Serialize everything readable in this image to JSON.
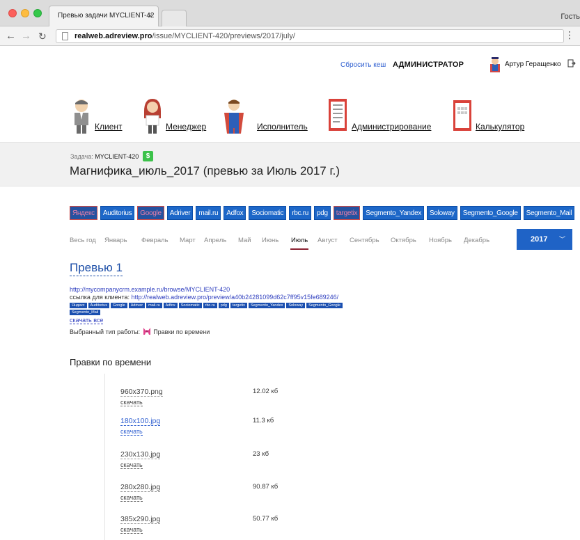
{
  "browser": {
    "tab_title": "Превью задачи MYCLIENT-42",
    "guest_label": "Гость",
    "url_host": "realweb.adreview.pro",
    "url_path": "/issue/MYCLIENT-420/previews/2017/july/"
  },
  "header": {
    "reset_cache": "Сбросить кеш",
    "role": "АДМИНИСТРАТОР",
    "user_name": "Артур Геращенко"
  },
  "nav": {
    "items": [
      {
        "label": "Клиент",
        "icon": "client-icon"
      },
      {
        "label": "Менеджер",
        "icon": "manager-icon"
      },
      {
        "label": "Исполнитель",
        "icon": "executor-icon"
      },
      {
        "label": "Администрирование",
        "icon": "admin-icon"
      },
      {
        "label": "Калькулятор",
        "icon": "calculator-icon"
      }
    ]
  },
  "task": {
    "label": "Задача:",
    "code": "MYCLIENT-420",
    "title": "Магнифика_июль_2017 (превью за Июль 2017 г.)"
  },
  "platforms": [
    {
      "label": "Яндекс",
      "active": false
    },
    {
      "label": "Auditorius",
      "active": true
    },
    {
      "label": "Google",
      "active": false
    },
    {
      "label": "Adriver",
      "active": true
    },
    {
      "label": "mail.ru",
      "active": true
    },
    {
      "label": "Adfox",
      "active": true
    },
    {
      "label": "Sociomatic",
      "active": true
    },
    {
      "label": "rbc.ru",
      "active": true
    },
    {
      "label": "pdg",
      "active": true
    },
    {
      "label": "targetix",
      "active": false
    },
    {
      "label": "Segmento_Yandex",
      "active": true
    },
    {
      "label": "Soloway",
      "active": true
    },
    {
      "label": "Segmento_Google",
      "active": true
    },
    {
      "label": "Segmento_Mail",
      "active": true
    }
  ],
  "months": [
    "Весь год",
    "Январь",
    "Февраль",
    "Март",
    "Апрель",
    "Май",
    "Июнь",
    "Июль",
    "Август",
    "Сентябрь",
    "Октябрь",
    "Ноябрь",
    "Декабрь"
  ],
  "active_month": "Июль",
  "year": "2017",
  "preview": {
    "title": "Превью 1",
    "crm_link": "http://mycompanycrm.example.ru/browse/MYCLIENT-420",
    "client_link_label": "ссылка для клиента:",
    "client_link": "http://realweb.adreview.pro/preview/a40b24281099d62c7ff95v15fe689246/",
    "tags": [
      "Яндекс",
      "Auditorius",
      "Google",
      "Adriver",
      "mail.ru",
      "Adfox",
      "Sociomatic",
      "rbc.ru",
      "pdg",
      "targetix",
      "Segmento_Yandex",
      "Soloway",
      "Segmento_Google",
      "Segmento_Mail"
    ],
    "download_all": "скачать все",
    "work_type_label": "Выбранный тип работы:",
    "work_type": "Правки по времени"
  },
  "section_title": "Правки по времени",
  "files": [
    {
      "name": "960x370.png",
      "size": "12.02 кб",
      "download": "скачать",
      "link": false
    },
    {
      "name": "180x100.jpg",
      "size": "11.3 кб",
      "download": "скачать",
      "link": true
    },
    {
      "name": "230x130.jpg",
      "size": "23 кб",
      "download": "скачать",
      "link": false
    },
    {
      "name": "280x280.jpg",
      "size": "90.87 кб",
      "download": "скачать",
      "link": false
    },
    {
      "name": "385x290.jpg",
      "size": "50.77 кб",
      "download": "скачать",
      "link": false
    }
  ],
  "colors": {
    "accent": "#1f63c6",
    "month_underline": "#8a2131",
    "link": "#2f5fd0"
  }
}
